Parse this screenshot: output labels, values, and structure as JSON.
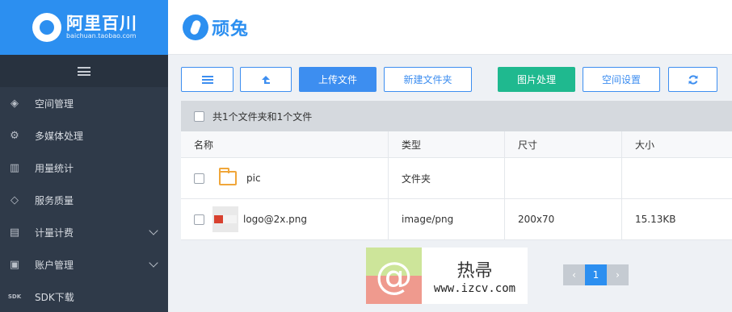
{
  "sidebar": {
    "brand_name": "阿里百川",
    "brand_sub": "baichuan.taobao.com",
    "items": [
      {
        "label": "空间管理",
        "icon": "storage-icon",
        "glyph": "◈",
        "expandable": false
      },
      {
        "label": "多媒体处理",
        "icon": "media-processing-icon",
        "glyph": "⚙",
        "expandable": false
      },
      {
        "label": "用量统计",
        "icon": "bar-chart-icon",
        "glyph": "▥",
        "expandable": false
      },
      {
        "label": "服务质量",
        "icon": "diamond-icon",
        "glyph": "◇",
        "expandable": false
      },
      {
        "label": "计量计费",
        "icon": "billing-icon",
        "glyph": "▤",
        "expandable": true
      },
      {
        "label": "账户管理",
        "icon": "account-icon",
        "glyph": "▣",
        "expandable": true
      },
      {
        "label": "SDK下载",
        "icon": "sdk-icon",
        "glyph": "SDK",
        "expandable": false
      }
    ]
  },
  "header": {
    "logo_text": "顽兔"
  },
  "toolbar": {
    "upload_label": "上传文件",
    "new_folder_label": "新建文件夹",
    "image_processing_label": "图片处理",
    "space_settings_label": "空间设置"
  },
  "files": {
    "summary": "共1个文件夹和1个文件",
    "columns": [
      "名称",
      "类型",
      "尺寸",
      "大小"
    ],
    "rows": [
      {
        "name": "pic",
        "type": "文件夹",
        "dimensions": "",
        "size": "",
        "kind": "folder"
      },
      {
        "name": "logo@2x.png",
        "type": "image/png",
        "dimensions": "200x70",
        "size": "15.13KB",
        "kind": "image"
      }
    ]
  },
  "pagination": {
    "current_page": "1",
    "prev_symbol": "‹",
    "next_symbol": "›"
  },
  "watermark": {
    "symbol": "@",
    "title": "热帚",
    "url": "www.izcv.com"
  },
  "colors": {
    "accent": "#2c8ff0",
    "sidebar_bg": "#2f3a49",
    "green": "#1fb98f"
  }
}
